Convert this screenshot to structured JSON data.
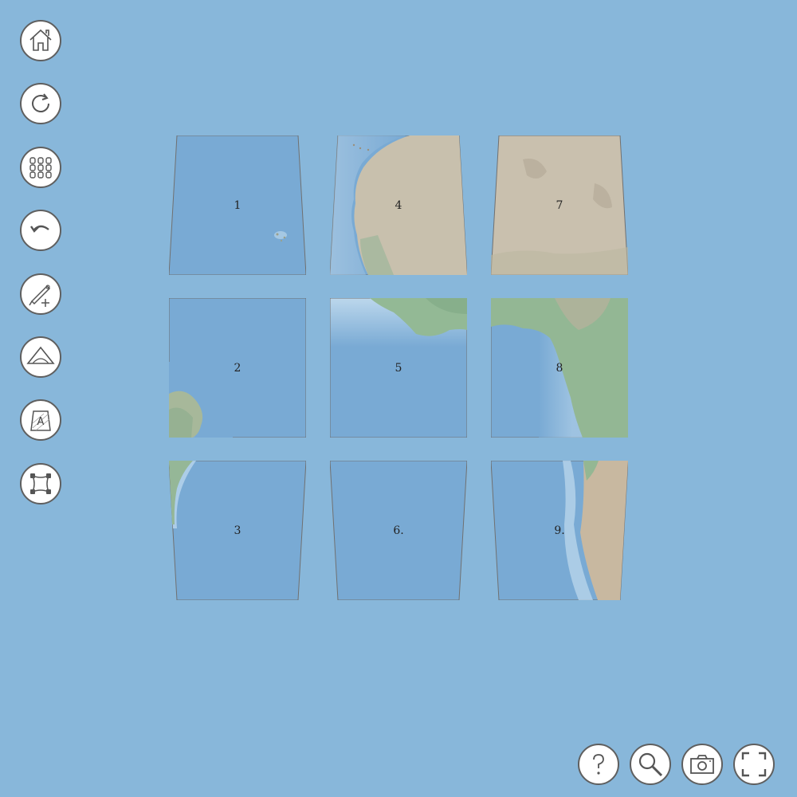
{
  "colors": {
    "background": "#88b7da",
    "ocean": "#78a9d2",
    "ocean_light": "#a8cde6",
    "land_green": "#8fb79a",
    "land_desert": "#c6bca9",
    "button_border": "#5f5f5f"
  },
  "toolbar": {
    "items": [
      {
        "name": "home-button",
        "icon": "home-icon"
      },
      {
        "name": "refresh-button",
        "icon": "refresh-icon"
      },
      {
        "name": "grid-button",
        "icon": "grid-icon"
      },
      {
        "name": "undo-button",
        "icon": "undo-icon"
      },
      {
        "name": "add-pen-button",
        "icon": "pen-plus-icon"
      },
      {
        "name": "shape-button",
        "icon": "triangle-icon"
      },
      {
        "name": "label-button",
        "icon": "label-tile-icon"
      },
      {
        "name": "corners-button",
        "icon": "corners-icon"
      }
    ]
  },
  "bottom_bar": {
    "items": [
      {
        "name": "help-button",
        "icon": "question-icon"
      },
      {
        "name": "zoom-button",
        "icon": "magnifier-icon"
      },
      {
        "name": "camera-button",
        "icon": "camera-icon"
      },
      {
        "name": "fullscreen-button",
        "icon": "fullscreen-icon"
      }
    ]
  },
  "tiles": [
    {
      "label": "1",
      "content": "ocean"
    },
    {
      "label": "2",
      "content": "ocean-with-coast-bottom-left"
    },
    {
      "label": "3",
      "content": "ocean-with-coast-left"
    },
    {
      "label": "4",
      "content": "west-africa-coast"
    },
    {
      "label": "5",
      "content": "gulf-of-guinea"
    },
    {
      "label": "6.",
      "content": "ocean"
    },
    {
      "label": "7",
      "content": "sahara"
    },
    {
      "label": "8",
      "content": "central-africa-coast"
    },
    {
      "label": "9.",
      "content": "southwest-africa-coast"
    }
  ]
}
